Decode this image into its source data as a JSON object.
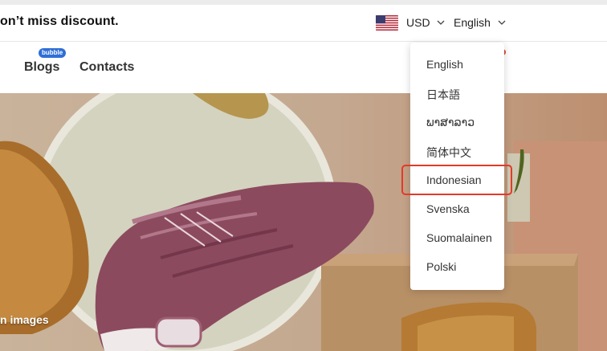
{
  "announcement": {
    "text": "on’t miss discount."
  },
  "currency": {
    "label": "USD",
    "flag_icon": "us-flag-icon"
  },
  "language": {
    "current": "English",
    "options": [
      "English",
      "日本語",
      "ພາສາລາວ",
      "简体中文",
      "Indonesian",
      "Svenska",
      "Suomalainen",
      "Polski"
    ],
    "highlighted": "Indonesian"
  },
  "nav": {
    "items": [
      "Blogs",
      "Contacts"
    ],
    "badge": "bubble"
  },
  "hero": {
    "caption": "n images"
  },
  "colors": {
    "highlight": "#e53929",
    "badge": "#2f6fd6",
    "background": "#ffffff"
  }
}
